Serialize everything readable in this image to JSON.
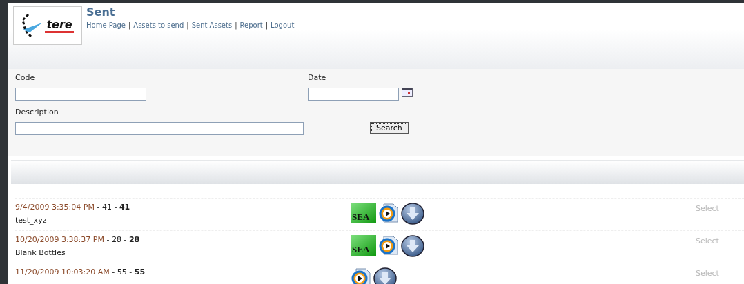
{
  "header": {
    "logo_text": "tere",
    "title": "Sent",
    "nav_separator": "|",
    "nav": [
      "Home Page",
      "Assets to send",
      "Sent Assets",
      "Report",
      "Logout"
    ]
  },
  "search_form": {
    "code_label": "Code",
    "date_label": "Date",
    "description_label": "Description",
    "search_button": "Search"
  },
  "results": [
    {
      "date": "9/4/2009 3:35:04 PM",
      "codes": "- 41 - **41**",
      "description": "test_xyz",
      "icons": [
        {
          "kind": "sea",
          "label": "SEA"
        },
        {
          "kind": "media"
        },
        {
          "kind": "download"
        }
      ],
      "action": "Select"
    },
    {
      "date": "10/20/2009 3:38:37 PM",
      "codes": "- 28 - **28**",
      "description": "Blank Bottles",
      "icons": [
        {
          "kind": "sea",
          "label": "SEA"
        },
        {
          "kind": "media"
        },
        {
          "kind": "download"
        }
      ],
      "action": "Select"
    },
    {
      "date": "11/20/2009 10:03:20 AM",
      "codes": "- 55 - **55**",
      "icons": [
        {
          "kind": "media"
        },
        {
          "kind": "download"
        }
      ],
      "action": "Select"
    }
  ]
}
